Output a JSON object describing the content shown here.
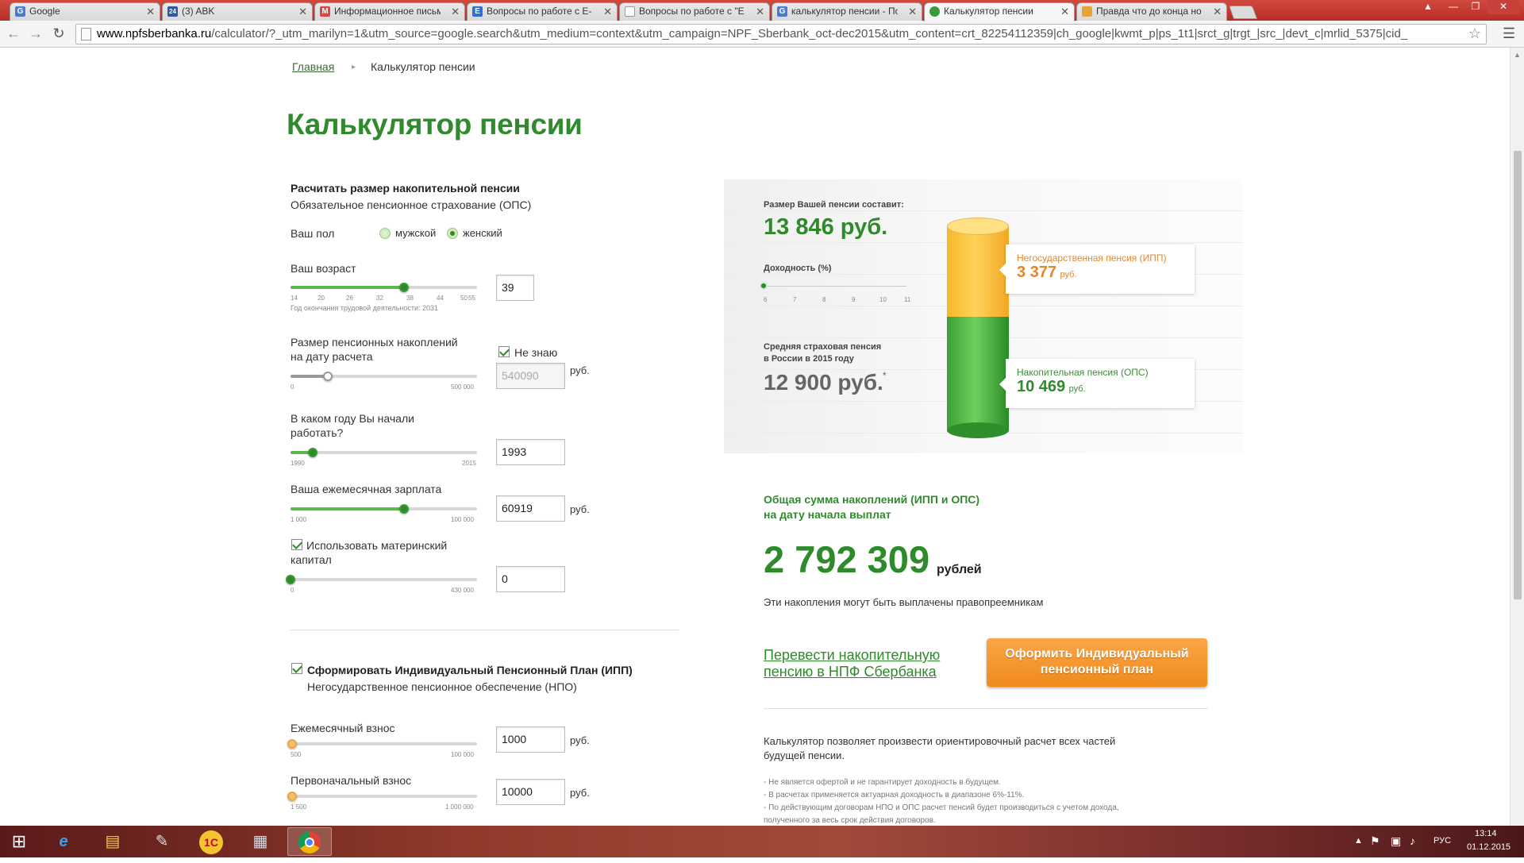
{
  "browser": {
    "tabs": [
      {
        "title": "Google",
        "favicon": "G",
        "color": "#4a7bd0"
      },
      {
        "title": "(3) ABK",
        "favicon": "24",
        "color": "#2d5aa0"
      },
      {
        "title": "Информационное письм",
        "favicon": "M",
        "color": "#d44"
      },
      {
        "title": "Вопросы по работе с Е-",
        "favicon": "E",
        "color": "#2f6fcf"
      },
      {
        "title": "Вопросы по работе с \"E",
        "favicon": "",
        "color": "#999"
      },
      {
        "title": "калькулятор пенсии - По",
        "favicon": "G",
        "color": "#4a7bd0"
      },
      {
        "title": "Калькулятор пенсии",
        "favicon": "",
        "color": "#3a9a3a"
      },
      {
        "title": "Правда что до конца но",
        "favicon": "",
        "color": "#e6a33a"
      }
    ],
    "url_host": "www.npfsberbanka.ru",
    "url_path": "/calculator/?_utm_marilyn=1&utm_source=google.search&utm_medium=context&utm_campaign=NPF_Sberbank_oct-dec2015&utm_content=crt_82254112359|ch_google|kwmt_p|ps_1t1|srct_g|trgt_|src_|devt_c|mrlid_5375|cid_"
  },
  "breadcrumb": {
    "home": "Главная",
    "current": "Калькулятор пенсии"
  },
  "page_title": "Калькулятор пенсии",
  "ops": {
    "heading": "Расчитать размер накопительной пенсии",
    "subheading": "Обязательное пенсионное страхование (ОПС)",
    "gender_label": "Ваш пол",
    "gender_male": "мужской",
    "gender_female": "женский",
    "age_label": "Ваш возраст",
    "age_value": "39",
    "age_ticks": [
      "14",
      "20",
      "26",
      "32",
      "38",
      "44",
      "50",
      "55"
    ],
    "age_note": "Год окончания трудовой деятельности: 2031",
    "savings_label_1": "Размер пенсионных накоплений",
    "savings_label_2": "на дату расчета",
    "dont_know": "Не знаю",
    "savings_value": "540090",
    "savings_min": "0",
    "savings_max": "500 000",
    "start_label_1": "В каком году Вы начали",
    "start_label_2": "работать?",
    "start_value": "1993",
    "start_min": "1990",
    "start_max": "2015",
    "salary_label": "Ваша ежемесячная зарплата",
    "salary_value": "60919",
    "salary_min": "1 000",
    "salary_max": "100 000",
    "maternity_label_1": "Использовать материнский",
    "maternity_label_2": "капитал",
    "maternity_value": "0",
    "maternity_min": "0",
    "maternity_max": "430 000",
    "currency": "руб."
  },
  "ipp": {
    "heading": "Сформировать Индивидуальный Пенсионный План (ИПП)",
    "subheading": "Негосударственное пенсионное обеспечение (НПО)",
    "monthly_label": "Ежемесячный взнос",
    "monthly_value": "1000",
    "monthly_min": "500",
    "monthly_max": "100 000",
    "initial_label": "Первоначальный взнос",
    "initial_value": "10000",
    "initial_min": "1 500",
    "initial_max": "1 000 000"
  },
  "result": {
    "pension_label": "Размер Вашей пенсии составит:",
    "pension_value": "13 846 руб.",
    "yield_label": "Доходность (%)",
    "yield_ticks": [
      "6",
      "7",
      "8",
      "9",
      "10",
      "11"
    ],
    "avg_label_1": "Средняя страховая пенсия",
    "avg_label_2": "в России в 2015 году",
    "avg_value": "12 900 руб.",
    "avg_mark": "*",
    "ipp_label": "Негосударственная пенсия (ИПП)",
    "ipp_value": "3 377",
    "ops_label": "Накопительная пенсия (ОПС)",
    "ops_value": "10 469",
    "unit": "руб.",
    "total_label_1": "Общая сумма накоплений (ИПП и ОПС)",
    "total_label_2": "на дату начала выплат",
    "total_value": "2 792 309",
    "total_unit": "рублей",
    "heirs": "Эти накопления могут быть выплачены правопреемникам",
    "transfer_link_1": "Перевести накопительную",
    "transfer_link_2": "пенсию в НПФ Сбербанка",
    "cta_1": "Оформить Индивидуальный",
    "cta_2": "пенсионный план",
    "about_1": "Калькулятор позволяет произвести ориентировочный расчет всех частей",
    "about_2": "будущей пенсии.",
    "notes": [
      "- Не является офертой и не гарантирует доходность в будущем.",
      "- В расчетах применяется актуарная доходность в диапазоне 6%-11%.",
      "- По действующим договорам НПО и ОПС расчет пенсий будет производиться с учетом дохода,",
      "полученного за весь срок действия договоров."
    ]
  },
  "sliders": {
    "age": 0.61,
    "savings": 0.2,
    "start_year": 0.12,
    "salary": 0.61,
    "maternity": 0.0,
    "monthly": 0.01,
    "initial": 0.01,
    "yield": 0.0
  },
  "taskbar": {
    "lang": "РУС",
    "time": "13:14",
    "date": "01.12.2015"
  }
}
